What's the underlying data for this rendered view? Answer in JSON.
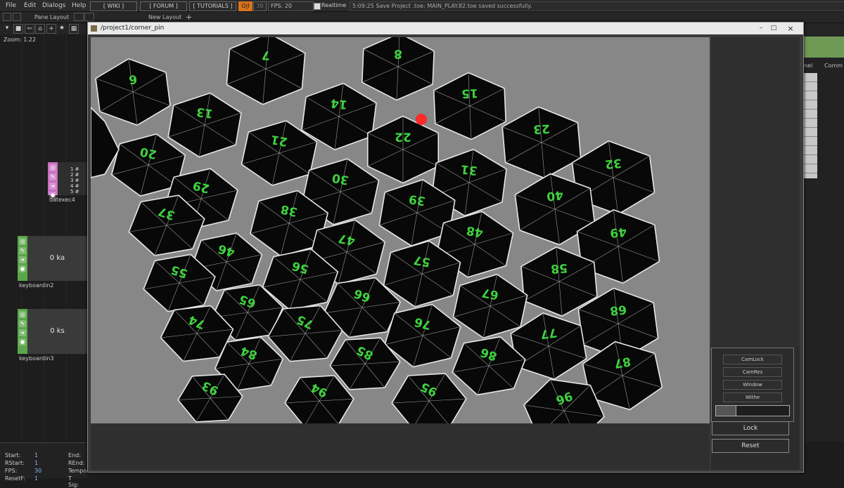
{
  "menu": [
    "File",
    "Edit",
    "Dialogs",
    "Help"
  ],
  "toolbar": {
    "wiki": "[ WIKI ]",
    "forum": "[ FORUM ]",
    "tutorials": "[ TUTORIALS ]",
    "oi": "O|I",
    "num30": "30",
    "fps": "FPS:  20",
    "realtime": "Realtime",
    "status": "5:09:25 Save Project .toe: MAIN_PLAY.82.toe saved successfully."
  },
  "bar2": {
    "pane_layout": "Pane Layout",
    "new_layout": "New Layout",
    "plus": "+"
  },
  "network": {
    "zoom": "Zoom: 1.22",
    "nodes": [
      {
        "name": "datexec4",
        "rows": [
          "1  #",
          "2  #",
          "3  #",
          "4  #",
          "5  #"
        ]
      },
      {
        "name": "keyboardin2",
        "value": "0 ka"
      },
      {
        "name": "keyboardin3",
        "value": "0 ks"
      }
    ]
  },
  "bottom_panel": {
    "rows": [
      {
        "k": "Start:",
        "v": "1",
        "k2": "End:"
      },
      {
        "k": "RStart:",
        "v": "1",
        "k2": "REnd:"
      },
      {
        "k": "FPS:",
        "v": "30",
        "k2": "Tempo"
      },
      {
        "k": "ResetF:",
        "v": "1",
        "k2": "T Sig:"
      }
    ]
  },
  "window": {
    "title": "/project1/corner_pin",
    "minimize": "–",
    "maximize": "□",
    "close": "×",
    "buttons": {
      "camlock": "CamLock",
      "camres": "CamRes",
      "window": "Window",
      "withe": "Withe",
      "lock": "Lock",
      "reset": "Reset"
    }
  },
  "right_strip": {
    "col1": "nnel",
    "col2": "Comm"
  },
  "hexagons": [
    "6",
    "7",
    "8",
    "13",
    "14",
    "15",
    "20",
    "21",
    "22",
    "23",
    "29",
    "30",
    "31",
    "32",
    "37",
    "38",
    "39",
    "40",
    "46",
    "47",
    "48",
    "49",
    "55",
    "56",
    "57",
    "58",
    "65",
    "66",
    "67",
    "68",
    "74",
    "75",
    "76",
    "77",
    "84",
    "85",
    "86",
    "87",
    "93",
    "94",
    "95",
    "96"
  ],
  "colors": {
    "accent_green": "#3fd23f",
    "node_green": "#5aa64a",
    "node_pink": "#c86ec0",
    "red_handle": "#ff2a2a"
  }
}
